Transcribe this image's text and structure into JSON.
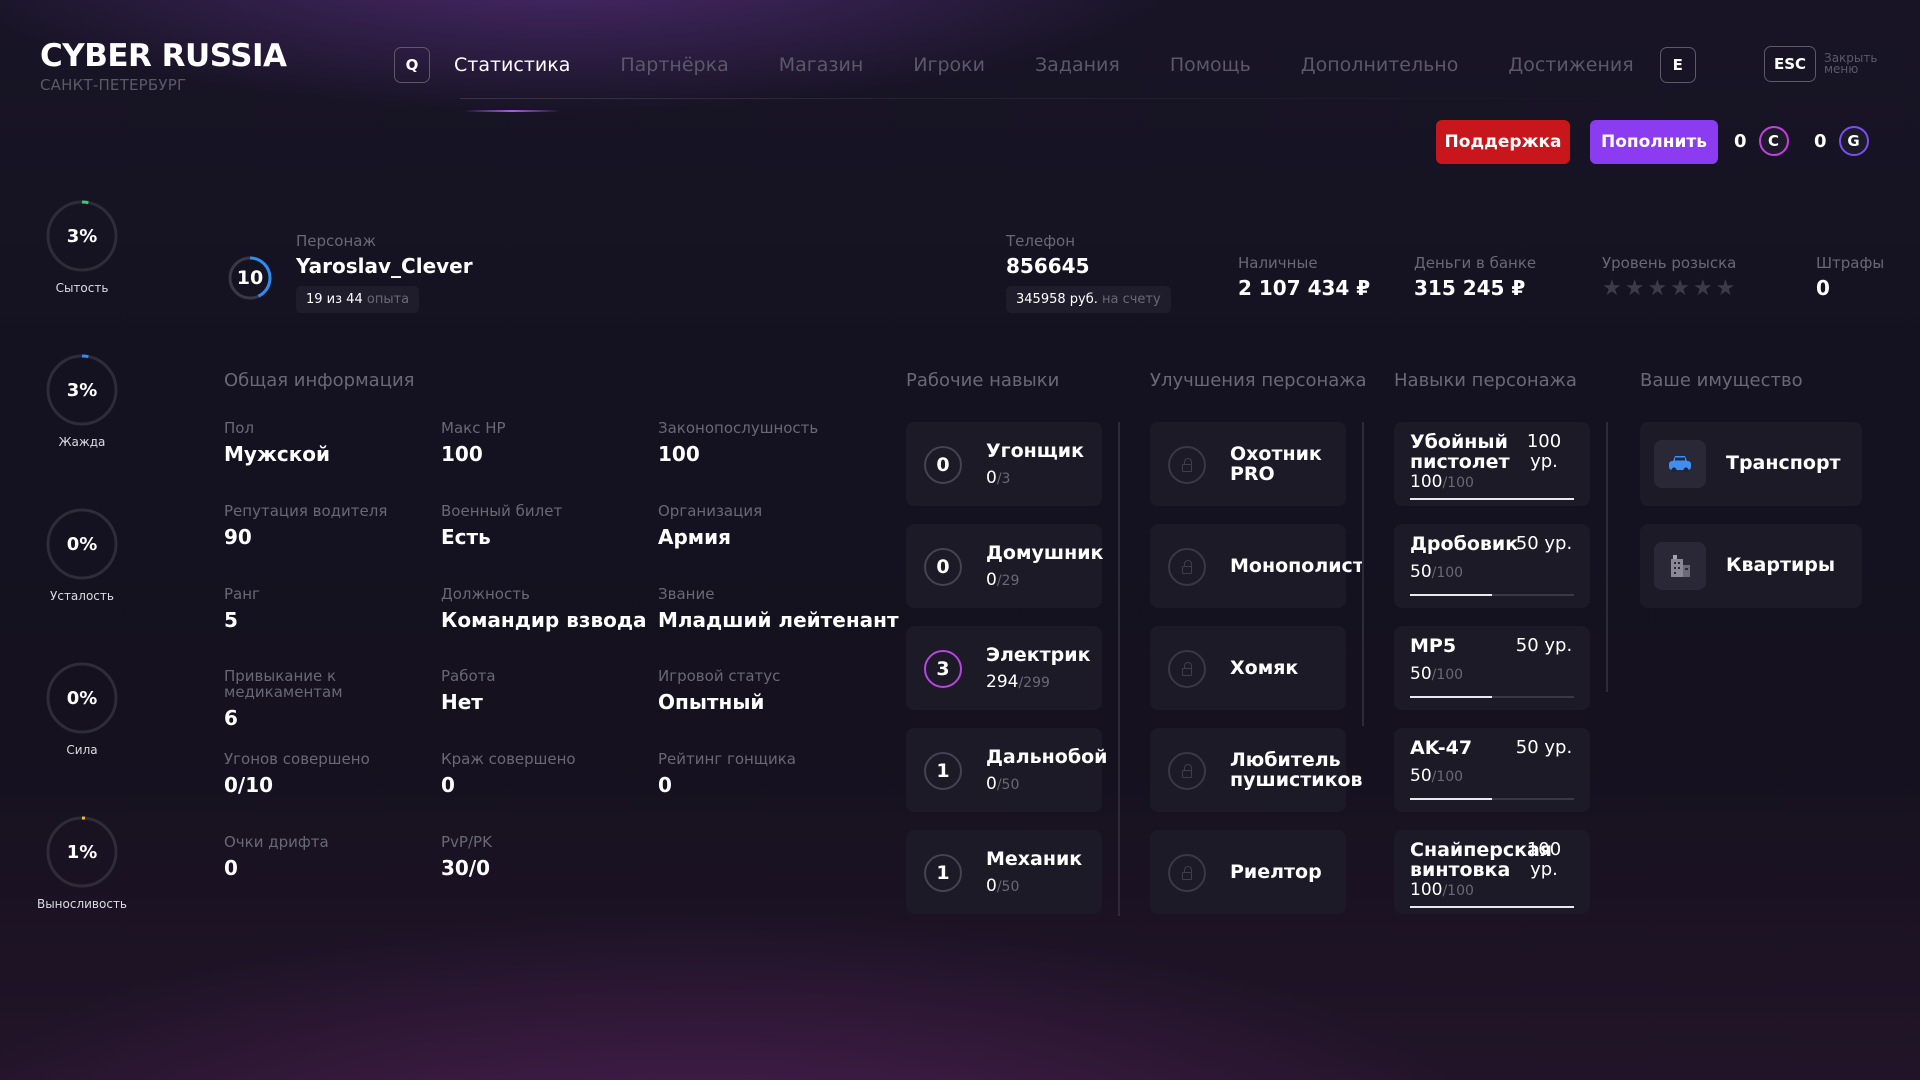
{
  "header": {
    "logo": "CYBER RUSSIA",
    "city": "САНКТ-ПЕТЕРБУРГ",
    "key_left": "Q",
    "key_right": "E",
    "nav": [
      "Статистика",
      "Партнёрка",
      "Магазин",
      "Игроки",
      "Задания",
      "Помощь",
      "Дополнительно",
      "Достижения"
    ],
    "esc_key": "ESC",
    "esc_label": "Закрыть меню"
  },
  "actions": {
    "support": "Поддержка",
    "topup": "Пополнить",
    "currency_c": {
      "value": "0",
      "icon": "C"
    },
    "currency_g": {
      "value": "0",
      "icon": "G"
    }
  },
  "needs": [
    {
      "label": "Сытость",
      "value": "3%",
      "fraction": 0.03,
      "color": "#2fcf6f"
    },
    {
      "label": "Жажда",
      "value": "3%",
      "fraction": 0.03,
      "color": "#2f8cf0"
    },
    {
      "label": "Усталость",
      "value": "0%",
      "fraction": 0,
      "color": "#888888"
    },
    {
      "label": "Сила",
      "value": "0%",
      "fraction": 0,
      "color": "#888888"
    },
    {
      "label": "Выносливость",
      "value": "1%",
      "fraction": 0.01,
      "color": "#f0c02f"
    }
  ],
  "profile": {
    "level": "10",
    "level_fraction": 0.43,
    "character_label": "Персонаж",
    "character_name": "Yaroslav_Clever",
    "exp_value": "19 из 44",
    "exp_unit": "опыта",
    "phone_label": "Телефон",
    "phone_number": "856645",
    "phone_balance": "345958 руб.",
    "phone_balance_suffix": "на счету",
    "cash_label": "Наличные",
    "cash_value": "2 107 434 ₽",
    "bank_label": "Деньги в банке",
    "bank_value": "315 245 ₽",
    "wanted_label": "Уровень розыска",
    "wanted_stars": 0,
    "fines_label": "Штрафы",
    "fines_value": "0"
  },
  "general": {
    "title": "Общая информация",
    "items": [
      {
        "label": "Пол",
        "value": "Мужской"
      },
      {
        "label": "Макс HP",
        "value": "100"
      },
      {
        "label": "Законопослушность",
        "value": "100"
      },
      {
        "label": "Репутация водителя",
        "value": "90"
      },
      {
        "label": "Военный билет",
        "value": "Есть"
      },
      {
        "label": "Организация",
        "value": "Армия"
      },
      {
        "label": "Ранг",
        "value": "5"
      },
      {
        "label": "Должность",
        "value": "Командир взвода"
      },
      {
        "label": "Звание",
        "value": "Младший лейтенант"
      },
      {
        "label": "Привыкание к медикаментам",
        "value": "6"
      },
      {
        "label": "Работа",
        "value": "Нет"
      },
      {
        "label": "Игровой статус",
        "value": "Опытный"
      },
      {
        "label": "Угонов совершено",
        "value": "0/10"
      },
      {
        "label": "Краж совершено",
        "value": "0"
      },
      {
        "label": "Рейтинг гонщика",
        "value": "0"
      },
      {
        "label": "Очки дрифта",
        "value": "0"
      },
      {
        "label": "PvP/PK",
        "value": "30/0"
      }
    ]
  },
  "work_skills": {
    "title": "Рабочие навыки",
    "items": [
      {
        "level": "0",
        "name": "Угонщик",
        "current": "0",
        "max": "/3"
      },
      {
        "level": "0",
        "name": "Домушник",
        "current": "0",
        "max": "/29"
      },
      {
        "level": "3",
        "name": "Электрик",
        "current": "294",
        "max": "/299"
      },
      {
        "level": "1",
        "name": "Дальнобой",
        "current": "0",
        "max": "/50"
      },
      {
        "level": "1",
        "name": "Механик",
        "current": "0",
        "max": "/50"
      }
    ]
  },
  "upgrades": {
    "title": "Улучшения персонажа",
    "items": [
      {
        "name": "Охотник PRO"
      },
      {
        "name": "Монополист"
      },
      {
        "name": "Хомяк"
      },
      {
        "name": "Любитель пушистиков"
      },
      {
        "name": "Риелтор"
      }
    ]
  },
  "char_skills": {
    "title": "Навыки персонажа",
    "items": [
      {
        "name": "Убойный пистолет",
        "level": "100 ур.",
        "current": "100",
        "max": "/100",
        "fraction": 1.0
      },
      {
        "name": "Дробовик",
        "level": "50 ур.",
        "current": "50",
        "max": "/100",
        "fraction": 0.5
      },
      {
        "name": "MP5",
        "level": "50 ур.",
        "current": "50",
        "max": "/100",
        "fraction": 0.5
      },
      {
        "name": "AK-47",
        "level": "50 ур.",
        "current": "50",
        "max": "/100",
        "fraction": 0.5
      },
      {
        "name": "Снайперская винтовка",
        "level": "100 ур.",
        "current": "100",
        "max": "/100",
        "fraction": 1.0
      }
    ]
  },
  "property": {
    "title": "Ваше имущество",
    "items": [
      {
        "name": "Транспорт",
        "icon": "car-icon"
      },
      {
        "name": "Квартиры",
        "icon": "building-icon"
      }
    ]
  }
}
